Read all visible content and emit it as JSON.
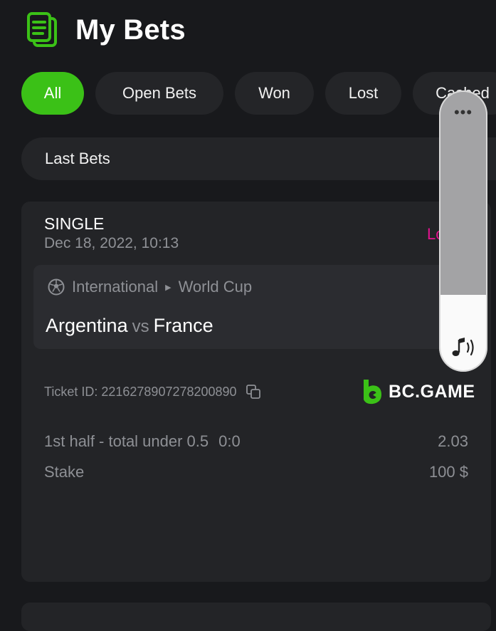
{
  "header": {
    "title": "My Bets",
    "icon": "bets-document-icon"
  },
  "filters": [
    {
      "label": "All",
      "active": true
    },
    {
      "label": "Open Bets",
      "active": false
    },
    {
      "label": "Won",
      "active": false
    },
    {
      "label": "Lost",
      "active": false
    },
    {
      "label": "Cashed",
      "active": false
    }
  ],
  "last_bets": {
    "label": "Last Bets"
  },
  "bet": {
    "type": "SINGLE",
    "date": "Dec 18, 2022, 10:13",
    "status": "Lost",
    "league": "International",
    "tournament": "World Cup",
    "home": "Argentina",
    "vs": "vs",
    "away": "France",
    "ticket_label": "Ticket ID:",
    "ticket_id": "2216278907278200890",
    "brand": "BC.GAME",
    "market": "1st half - total under 0.5",
    "score": "0:0",
    "odds": "2.03",
    "stake_label": "Stake",
    "stake_value": "100 $"
  },
  "volume": {
    "more_label": "•••",
    "level_fraction": 0.27
  },
  "colors": {
    "accent": "#3bc117",
    "status_lost": "#e3128f",
    "background": "#18191c",
    "card": "#232427"
  }
}
